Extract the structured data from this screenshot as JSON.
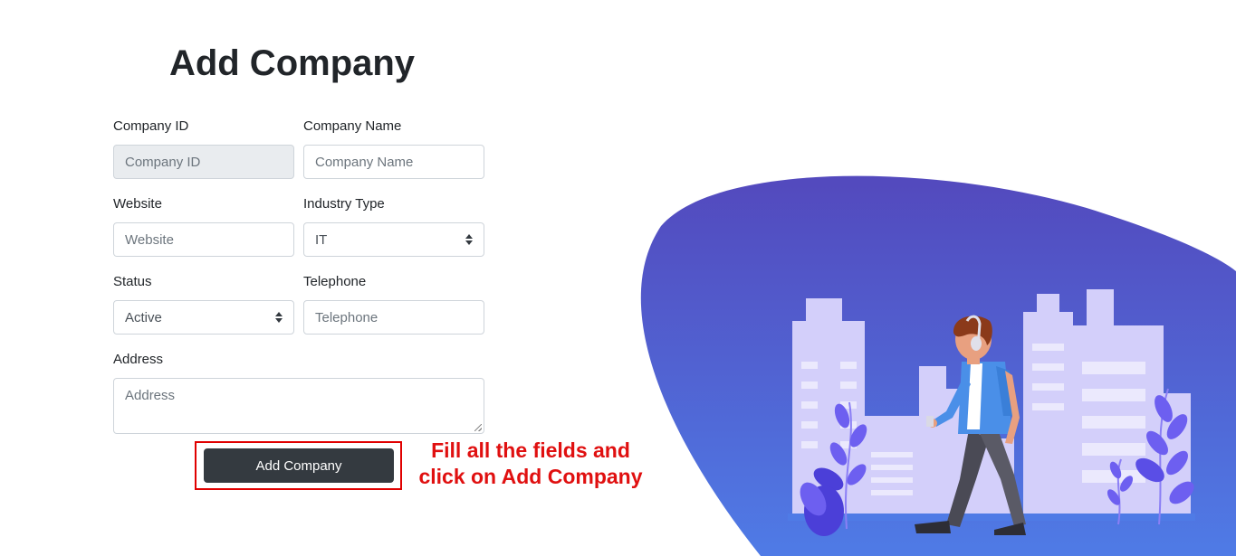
{
  "form": {
    "title": "Add Company",
    "company_id": {
      "label": "Company ID",
      "placeholder": "Company ID"
    },
    "company_name": {
      "label": "Company Name",
      "placeholder": "Company Name"
    },
    "website": {
      "label": "Website",
      "placeholder": "Website"
    },
    "industry_type": {
      "label": "Industry Type",
      "value": "IT"
    },
    "status": {
      "label": "Status",
      "value": "Active"
    },
    "telephone": {
      "label": "Telephone",
      "placeholder": "Telephone"
    },
    "address": {
      "label": "Address",
      "placeholder": "Address"
    },
    "submit_label": "Add Company"
  },
  "annotation": {
    "line1": "Fill all the fields and",
    "line2": "click on Add Company",
    "color": "#e01010"
  },
  "illustration": {
    "icon": "person-walking-city-illustration",
    "blob_colors": [
      "#5349bd",
      "#4f7be6"
    ]
  }
}
